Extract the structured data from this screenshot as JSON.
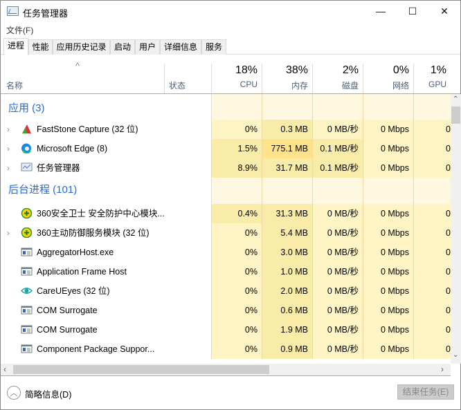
{
  "window": {
    "title": "任务管理器",
    "minimize": "—",
    "maximize": "☐",
    "close": "✕"
  },
  "menu": {
    "file": "文件(F)"
  },
  "tabs": [
    "进程",
    "性能",
    "应用历史记录",
    "启动",
    "用户",
    "详细信息",
    "服务"
  ],
  "header": {
    "name": "名称",
    "status": "状态",
    "sort_arrow": "^",
    "columns": [
      {
        "pct": "18%",
        "label": "CPU"
      },
      {
        "pct": "38%",
        "label": "内存"
      },
      {
        "pct": "2%",
        "label": "磁盘"
      },
      {
        "pct": "0%",
        "label": "网络"
      },
      {
        "pct": "1%",
        "label": "GPU"
      }
    ]
  },
  "groups": [
    {
      "title": "应用 (3)",
      "rows": [
        {
          "name": "FastStone Capture (32 位)",
          "icon": "faststone-icon",
          "expand": true,
          "cpu": "0%",
          "mem": "0.3 MB",
          "disk": "0 MB/秒",
          "net": "0 Mbps",
          "gpu": "0",
          "heat": [
            0,
            1,
            0,
            0,
            0
          ]
        },
        {
          "name": "Microsoft Edge (8)",
          "icon": "edge-icon",
          "expand": true,
          "cpu": "1.5%",
          "mem": "775.1 MB",
          "disk": "0.1 MB/秒",
          "net": "0 Mbps",
          "gpu": "0",
          "heat": [
            1,
            2,
            1,
            0,
            0
          ]
        },
        {
          "name": "任务管理器",
          "icon": "task-manager-icon",
          "expand": true,
          "cpu": "8.9%",
          "mem": "31.7 MB",
          "disk": "0.1 MB/秒",
          "net": "0 Mbps",
          "gpu": "0",
          "heat": [
            1,
            1,
            1,
            0,
            0
          ]
        }
      ]
    },
    {
      "title": "后台进程 (101)",
      "rows": [
        {
          "name": "360安全卫士 安全防护中心模块...",
          "icon": "360-icon",
          "expand": false,
          "cpu": "0.4%",
          "mem": "31.3 MB",
          "disk": "0 MB/秒",
          "net": "0 Mbps",
          "gpu": "0",
          "heat": [
            1,
            1,
            0,
            0,
            0
          ]
        },
        {
          "name": "360主动防御服务模块 (32 位)",
          "icon": "360-icon",
          "expand": true,
          "cpu": "0%",
          "mem": "5.4 MB",
          "disk": "0 MB/秒",
          "net": "0 Mbps",
          "gpu": "0",
          "heat": [
            0,
            1,
            0,
            0,
            0
          ]
        },
        {
          "name": "AggregatorHost.exe",
          "icon": "window-app-icon",
          "expand": false,
          "cpu": "0%",
          "mem": "3.0 MB",
          "disk": "0 MB/秒",
          "net": "0 Mbps",
          "gpu": "0",
          "heat": [
            0,
            1,
            0,
            0,
            0
          ]
        },
        {
          "name": "Application Frame Host",
          "icon": "window-app-icon",
          "expand": false,
          "cpu": "0%",
          "mem": "1.0 MB",
          "disk": "0 MB/秒",
          "net": "0 Mbps",
          "gpu": "0",
          "heat": [
            0,
            1,
            0,
            0,
            0
          ]
        },
        {
          "name": "CareUEyes (32 位)",
          "icon": "eye-icon",
          "expand": false,
          "cpu": "0%",
          "mem": "2.0 MB",
          "disk": "0 MB/秒",
          "net": "0 Mbps",
          "gpu": "0",
          "heat": [
            0,
            1,
            0,
            0,
            0
          ]
        },
        {
          "name": "COM Surrogate",
          "icon": "window-app-icon",
          "expand": false,
          "cpu": "0%",
          "mem": "0.6 MB",
          "disk": "0 MB/秒",
          "net": "0 Mbps",
          "gpu": "0",
          "heat": [
            0,
            1,
            0,
            0,
            0
          ]
        },
        {
          "name": "COM Surrogate",
          "icon": "window-app-icon",
          "expand": false,
          "cpu": "0%",
          "mem": "1.9 MB",
          "disk": "0 MB/秒",
          "net": "0 Mbps",
          "gpu": "0",
          "heat": [
            0,
            1,
            0,
            0,
            0
          ]
        },
        {
          "name": "Component Package Suppor...",
          "icon": "window-app-icon",
          "expand": false,
          "cpu": "0%",
          "mem": "0.9 MB",
          "disk": "0 MB/秒",
          "net": "0 Mbps",
          "gpu": "0",
          "heat": [
            0,
            1,
            0,
            0,
            0
          ]
        }
      ]
    }
  ],
  "footer": {
    "fewer_details": "简略信息(D)",
    "end_task": "结束任务(E)"
  }
}
